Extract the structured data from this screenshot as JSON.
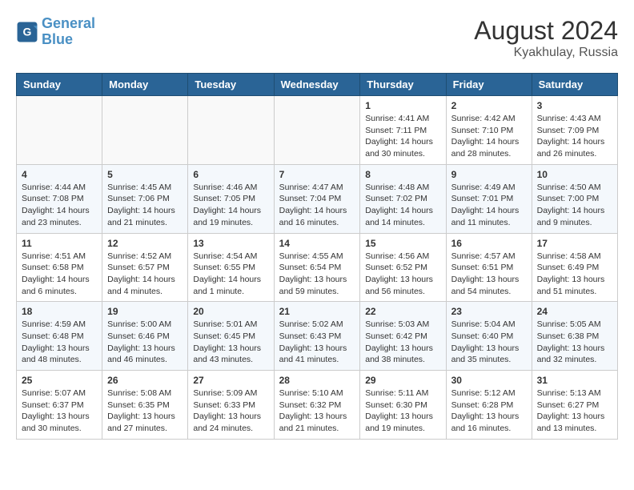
{
  "header": {
    "logo_line1": "General",
    "logo_line2": "Blue",
    "month_year": "August 2024",
    "location": "Kyakhulay, Russia"
  },
  "weekdays": [
    "Sunday",
    "Monday",
    "Tuesday",
    "Wednesday",
    "Thursday",
    "Friday",
    "Saturday"
  ],
  "weeks": [
    [
      {
        "day": "",
        "info": ""
      },
      {
        "day": "",
        "info": ""
      },
      {
        "day": "",
        "info": ""
      },
      {
        "day": "",
        "info": ""
      },
      {
        "day": "1",
        "info": "Sunrise: 4:41 AM\nSunset: 7:11 PM\nDaylight: 14 hours\nand 30 minutes."
      },
      {
        "day": "2",
        "info": "Sunrise: 4:42 AM\nSunset: 7:10 PM\nDaylight: 14 hours\nand 28 minutes."
      },
      {
        "day": "3",
        "info": "Sunrise: 4:43 AM\nSunset: 7:09 PM\nDaylight: 14 hours\nand 26 minutes."
      }
    ],
    [
      {
        "day": "4",
        "info": "Sunrise: 4:44 AM\nSunset: 7:08 PM\nDaylight: 14 hours\nand 23 minutes."
      },
      {
        "day": "5",
        "info": "Sunrise: 4:45 AM\nSunset: 7:06 PM\nDaylight: 14 hours\nand 21 minutes."
      },
      {
        "day": "6",
        "info": "Sunrise: 4:46 AM\nSunset: 7:05 PM\nDaylight: 14 hours\nand 19 minutes."
      },
      {
        "day": "7",
        "info": "Sunrise: 4:47 AM\nSunset: 7:04 PM\nDaylight: 14 hours\nand 16 minutes."
      },
      {
        "day": "8",
        "info": "Sunrise: 4:48 AM\nSunset: 7:02 PM\nDaylight: 14 hours\nand 14 minutes."
      },
      {
        "day": "9",
        "info": "Sunrise: 4:49 AM\nSunset: 7:01 PM\nDaylight: 14 hours\nand 11 minutes."
      },
      {
        "day": "10",
        "info": "Sunrise: 4:50 AM\nSunset: 7:00 PM\nDaylight: 14 hours\nand 9 minutes."
      }
    ],
    [
      {
        "day": "11",
        "info": "Sunrise: 4:51 AM\nSunset: 6:58 PM\nDaylight: 14 hours\nand 6 minutes."
      },
      {
        "day": "12",
        "info": "Sunrise: 4:52 AM\nSunset: 6:57 PM\nDaylight: 14 hours\nand 4 minutes."
      },
      {
        "day": "13",
        "info": "Sunrise: 4:54 AM\nSunset: 6:55 PM\nDaylight: 14 hours\nand 1 minute."
      },
      {
        "day": "14",
        "info": "Sunrise: 4:55 AM\nSunset: 6:54 PM\nDaylight: 13 hours\nand 59 minutes."
      },
      {
        "day": "15",
        "info": "Sunrise: 4:56 AM\nSunset: 6:52 PM\nDaylight: 13 hours\nand 56 minutes."
      },
      {
        "day": "16",
        "info": "Sunrise: 4:57 AM\nSunset: 6:51 PM\nDaylight: 13 hours\nand 54 minutes."
      },
      {
        "day": "17",
        "info": "Sunrise: 4:58 AM\nSunset: 6:49 PM\nDaylight: 13 hours\nand 51 minutes."
      }
    ],
    [
      {
        "day": "18",
        "info": "Sunrise: 4:59 AM\nSunset: 6:48 PM\nDaylight: 13 hours\nand 48 minutes."
      },
      {
        "day": "19",
        "info": "Sunrise: 5:00 AM\nSunset: 6:46 PM\nDaylight: 13 hours\nand 46 minutes."
      },
      {
        "day": "20",
        "info": "Sunrise: 5:01 AM\nSunset: 6:45 PM\nDaylight: 13 hours\nand 43 minutes."
      },
      {
        "day": "21",
        "info": "Sunrise: 5:02 AM\nSunset: 6:43 PM\nDaylight: 13 hours\nand 41 minutes."
      },
      {
        "day": "22",
        "info": "Sunrise: 5:03 AM\nSunset: 6:42 PM\nDaylight: 13 hours\nand 38 minutes."
      },
      {
        "day": "23",
        "info": "Sunrise: 5:04 AM\nSunset: 6:40 PM\nDaylight: 13 hours\nand 35 minutes."
      },
      {
        "day": "24",
        "info": "Sunrise: 5:05 AM\nSunset: 6:38 PM\nDaylight: 13 hours\nand 32 minutes."
      }
    ],
    [
      {
        "day": "25",
        "info": "Sunrise: 5:07 AM\nSunset: 6:37 PM\nDaylight: 13 hours\nand 30 minutes."
      },
      {
        "day": "26",
        "info": "Sunrise: 5:08 AM\nSunset: 6:35 PM\nDaylight: 13 hours\nand 27 minutes."
      },
      {
        "day": "27",
        "info": "Sunrise: 5:09 AM\nSunset: 6:33 PM\nDaylight: 13 hours\nand 24 minutes."
      },
      {
        "day": "28",
        "info": "Sunrise: 5:10 AM\nSunset: 6:32 PM\nDaylight: 13 hours\nand 21 minutes."
      },
      {
        "day": "29",
        "info": "Sunrise: 5:11 AM\nSunset: 6:30 PM\nDaylight: 13 hours\nand 19 minutes."
      },
      {
        "day": "30",
        "info": "Sunrise: 5:12 AM\nSunset: 6:28 PM\nDaylight: 13 hours\nand 16 minutes."
      },
      {
        "day": "31",
        "info": "Sunrise: 5:13 AM\nSunset: 6:27 PM\nDaylight: 13 hours\nand 13 minutes."
      }
    ]
  ]
}
